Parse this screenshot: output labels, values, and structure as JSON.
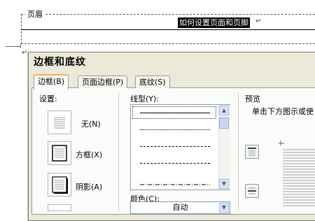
{
  "document": {
    "header_tag": "页眉",
    "header_text": "如何设置页面和页脚",
    "paragraph_mark": "↵"
  },
  "dialog": {
    "title": "边框和底纹",
    "tabs": [
      {
        "label": "边框(B)",
        "active": true
      },
      {
        "label": "页面边框(P)",
        "active": false
      },
      {
        "label": "底纹(S)",
        "active": false
      }
    ],
    "setting_label": "设置:",
    "presets": [
      {
        "label": "无(N)"
      },
      {
        "label": "方框(X)"
      },
      {
        "label": "阴影(A)"
      }
    ],
    "line_style_label": "线型(Y):",
    "line_styles": [
      "solid",
      "dotted-fine",
      "dashed-short",
      "dashed",
      "dash-dot"
    ],
    "color_label": "颜色(C):",
    "color_value": "自动",
    "preview_label": "预览",
    "preview_hint": "单击下方图示或使"
  },
  "colors": {
    "dialog_bg": "#ece9d8",
    "tab_panel_bg": "#fbfbf9",
    "active_tab_accent": "#f3b23b",
    "border_blue": "#7f9db9"
  }
}
